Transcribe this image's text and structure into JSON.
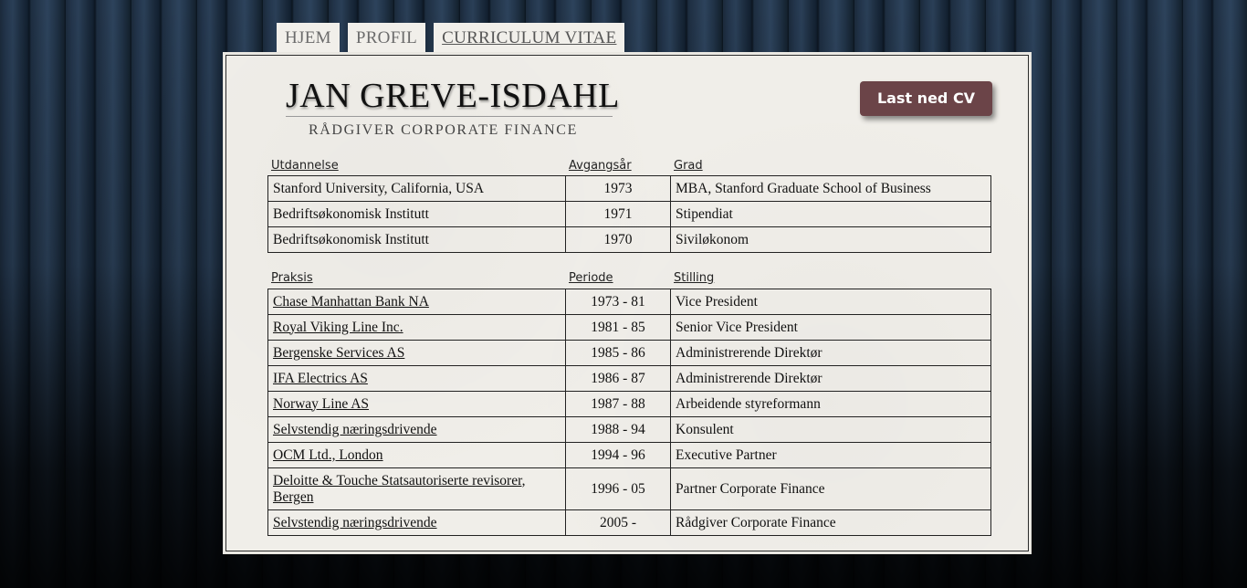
{
  "nav": {
    "tabs": [
      {
        "label": "HJEM"
      },
      {
        "label": "PROFIL"
      },
      {
        "label": "CURRICULUM VITAE"
      }
    ]
  },
  "header": {
    "name": "JAN GREVE-ISDAHL",
    "title": "RÅDGIVER CORPORATE FINANCE",
    "download_label": "Last ned CV"
  },
  "education": {
    "headers": [
      "Utdannelse",
      "Avgangsår",
      "Grad"
    ],
    "rows": [
      {
        "institution": "Stanford University, California, USA",
        "year": "1973",
        "degree": "MBA, Stanford Graduate School of Business"
      },
      {
        "institution": "Bedriftsøkonomisk Institutt",
        "year": "1971",
        "degree": "Stipendiat"
      },
      {
        "institution": "Bedriftsøkonomisk Institutt",
        "year": "1970",
        "degree": "Siviløkonom"
      }
    ]
  },
  "practice": {
    "headers": [
      "Praksis",
      "Periode",
      "Stilling"
    ],
    "rows": [
      {
        "employer": "Chase Manhattan Bank NA",
        "period": "1973 - 81",
        "position": "Vice President"
      },
      {
        "employer": "Royal Viking Line Inc.",
        "period": "1981 - 85",
        "position": "Senior Vice President"
      },
      {
        "employer": "Bergenske Services AS",
        "period": "1985 - 86",
        "position": "Administrerende Direktør"
      },
      {
        "employer": "IFA Electrics AS",
        "period": "1986 - 87",
        "position": "Administrerende Direktør"
      },
      {
        "employer": "Norway Line AS",
        "period": "1987 - 88",
        "position": "Arbeidende styreformann"
      },
      {
        "employer": "Selvstendig næringsdrivende",
        "period": "1988 - 94",
        "position": "Konsulent"
      },
      {
        "employer": "OCM Ltd., London",
        "period": "1994 - 96",
        "position": "Executive Partner"
      },
      {
        "employer": "Deloitte & Touche Statsautoriserte revisorer, Bergen",
        "period": "1996 - 05",
        "position": "Partner Corporate Finance"
      },
      {
        "employer": "Selvstendig næringsdrivende",
        "period": "2005 -",
        "position": "Rådgiver Corporate Finance"
      }
    ]
  },
  "colors": {
    "button": "#6b4448",
    "panel": "#f0eee9",
    "tab": "#f1efea"
  }
}
